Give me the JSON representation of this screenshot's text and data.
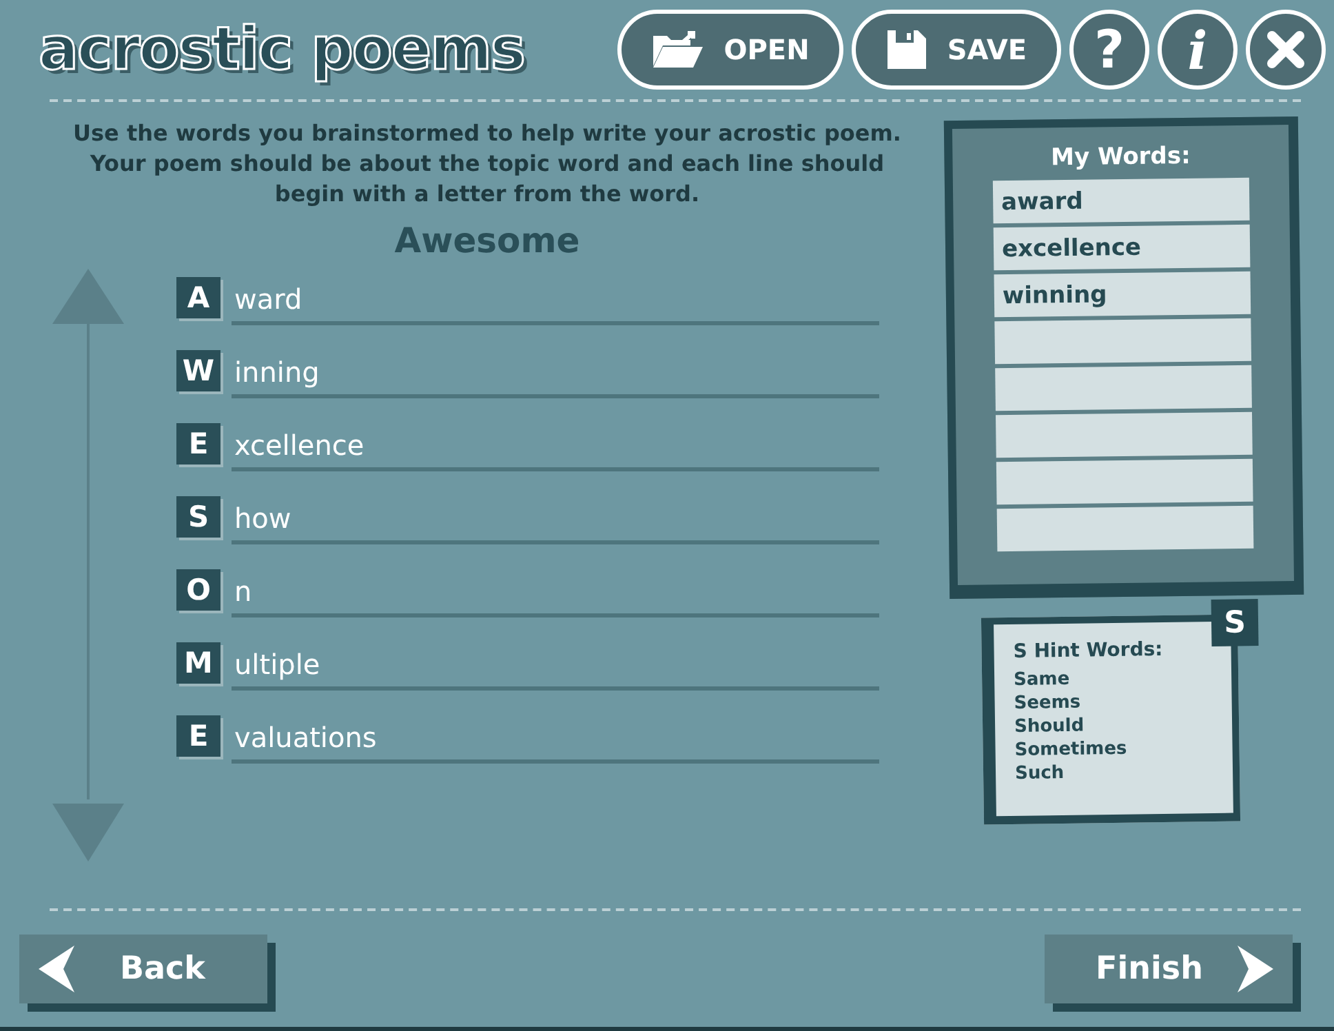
{
  "title": "acrostic poems",
  "toolbar": [
    {
      "kind": "open",
      "label": "OPEN"
    },
    {
      "kind": "save",
      "label": "SAVE"
    },
    {
      "kind": "help",
      "label": "?"
    },
    {
      "kind": "info",
      "label": "i"
    },
    {
      "kind": "close"
    }
  ],
  "instructions": "Use the words you brainstormed to help write your acrostic poem. Your poem should be about the topic word and each line should begin with a letter from the word.",
  "topic": "Awesome",
  "lines": [
    {
      "letter": "A",
      "value": "ward"
    },
    {
      "letter": "W",
      "value": "inning"
    },
    {
      "letter": "E",
      "value": "xcellence"
    },
    {
      "letter": "S",
      "value": "how"
    },
    {
      "letter": "O",
      "value": "n"
    },
    {
      "letter": "M",
      "value": "ultiple"
    },
    {
      "letter": "E",
      "value": "valuations"
    }
  ],
  "my_words": {
    "title": "My Words:",
    "words": [
      "award",
      "excellence",
      "winning"
    ]
  },
  "hints": {
    "badge": "S",
    "title": "S Hint Words:",
    "words": [
      "Same",
      "Seems",
      "Should",
      "Sometimes",
      "Such"
    ]
  },
  "nav": {
    "back": "Back",
    "finish": "Finish"
  }
}
